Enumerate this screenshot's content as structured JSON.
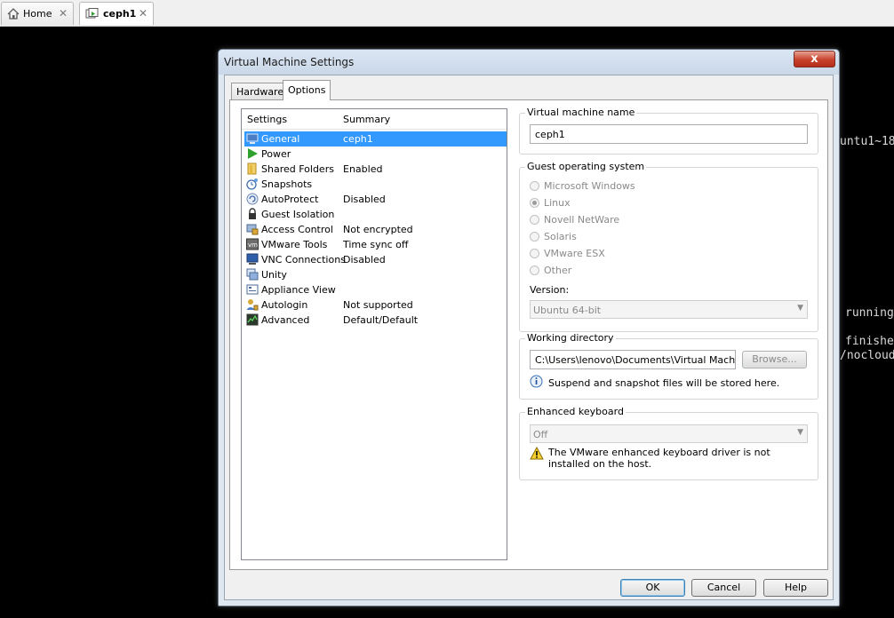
{
  "tabs": [
    {
      "label": "Home"
    },
    {
      "label": "ceph1"
    }
  ],
  "terminal": [
    "untu1~18",
    "running",
    "finishe",
    "/nocloud"
  ],
  "dialog": {
    "title": "Virtual Machine Settings",
    "close_label": "x",
    "tabs": {
      "hardware": "Hardware",
      "options": "Options"
    },
    "list": {
      "col_settings": "Settings",
      "col_summary": "Summary",
      "items": [
        {
          "name": "General",
          "summary": "ceph1",
          "icon": "general-icon"
        },
        {
          "name": "Power",
          "summary": "",
          "icon": "power-icon"
        },
        {
          "name": "Shared Folders",
          "summary": "Enabled",
          "icon": "folder-icon"
        },
        {
          "name": "Snapshots",
          "summary": "",
          "icon": "snapshot-icon"
        },
        {
          "name": "AutoProtect",
          "summary": "Disabled",
          "icon": "autoprotect-icon"
        },
        {
          "name": "Guest Isolation",
          "summary": "",
          "icon": "lock-icon"
        },
        {
          "name": "Access Control",
          "summary": "Not encrypted",
          "icon": "access-control-icon"
        },
        {
          "name": "VMware Tools",
          "summary": "Time sync off",
          "icon": "vmware-tools-icon"
        },
        {
          "name": "VNC Connections",
          "summary": "Disabled",
          "icon": "vnc-icon"
        },
        {
          "name": "Unity",
          "summary": "",
          "icon": "unity-icon"
        },
        {
          "name": "Appliance View",
          "summary": "",
          "icon": "appliance-icon"
        },
        {
          "name": "Autologin",
          "summary": "Not supported",
          "icon": "autologin-icon"
        },
        {
          "name": "Advanced",
          "summary": "Default/Default",
          "icon": "advanced-icon"
        }
      ]
    },
    "vm_name": {
      "title": "Virtual machine name",
      "value": "ceph1"
    },
    "guest_os": {
      "title": "Guest operating system",
      "options": [
        "Microsoft Windows",
        "Linux",
        "Novell NetWare",
        "Solaris",
        "VMware ESX",
        "Other"
      ],
      "selected": "Linux",
      "version_label": "Version:",
      "version_value": "Ubuntu 64-bit"
    },
    "working_dir": {
      "title": "Working directory",
      "value": "C:\\Users\\lenovo\\Documents\\Virtual Machines\\c",
      "browse_label": "Browse...",
      "info": "Suspend and snapshot files will be stored here."
    },
    "keyboard": {
      "title": "Enhanced keyboard",
      "value": "Off",
      "warning": "The VMware enhanced keyboard driver is not installed on the host."
    },
    "buttons": {
      "ok": "OK",
      "cancel": "Cancel",
      "help": "Help"
    },
    "colors": {
      "selection": "#3399ff",
      "accent": "#c8412c"
    }
  }
}
